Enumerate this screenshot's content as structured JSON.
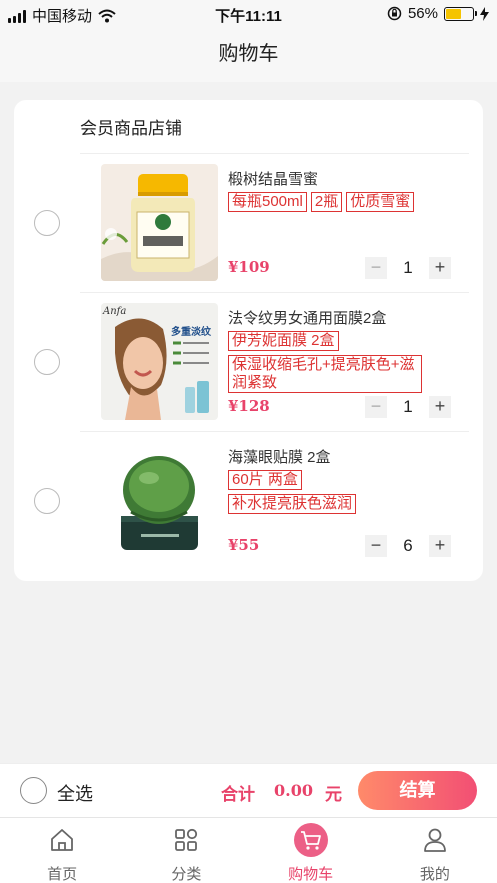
{
  "status_bar": {
    "carrier": "中国移动",
    "time": "下午11:11",
    "battery_percent": "56%",
    "battery_level": 0.56
  },
  "header": {
    "title": "购物车"
  },
  "shop": {
    "name": "会员商品店铺"
  },
  "items": [
    {
      "name": "椴树结晶雪蜜",
      "tags": [
        "每瓶500ml",
        "2瓶",
        "优质雪蜜"
      ],
      "price": "¥109",
      "quantity": "1",
      "image_icon": "honey-jar-icon"
    },
    {
      "name": "法令纹男女通用面膜2盒",
      "tags": [
        "伊芳妮面膜 2盒",
        "保湿收缩毛孔+提亮肤色+滋润紧致"
      ],
      "price": "¥128",
      "quantity": "1",
      "image_icon": "face-mask-product-icon",
      "image_brand": "Anfa",
      "image_caption": "多重淡纹",
      "image_bullets": [
        "淡化额头纹",
        "淡化川字纹",
        "改善法令纹"
      ]
    },
    {
      "name": "海藻眼贴膜 2盒",
      "tags": [
        "60片 两盒",
        "补水提亮肤色滋润"
      ],
      "price": "¥55",
      "quantity": "6",
      "image_icon": "eye-patch-jar-icon"
    }
  ],
  "checkout": {
    "select_all": "全选",
    "total_label": "合计",
    "total_value": "0.00",
    "currency": "元",
    "submit": "结算"
  },
  "tabs": [
    {
      "label": "首页",
      "icon": "home-icon"
    },
    {
      "label": "分类",
      "icon": "category-icon"
    },
    {
      "label": "购物车",
      "icon": "cart-icon",
      "active": true
    },
    {
      "label": "我的",
      "icon": "user-icon"
    }
  ],
  "stepper": {
    "minus": "−",
    "plus": "+"
  },
  "colors": {
    "accent": "#e8436a",
    "tag_border": "#dd3333",
    "checkout_gradient_start": "#ff8a6a",
    "checkout_gradient_end": "#f24f74"
  }
}
